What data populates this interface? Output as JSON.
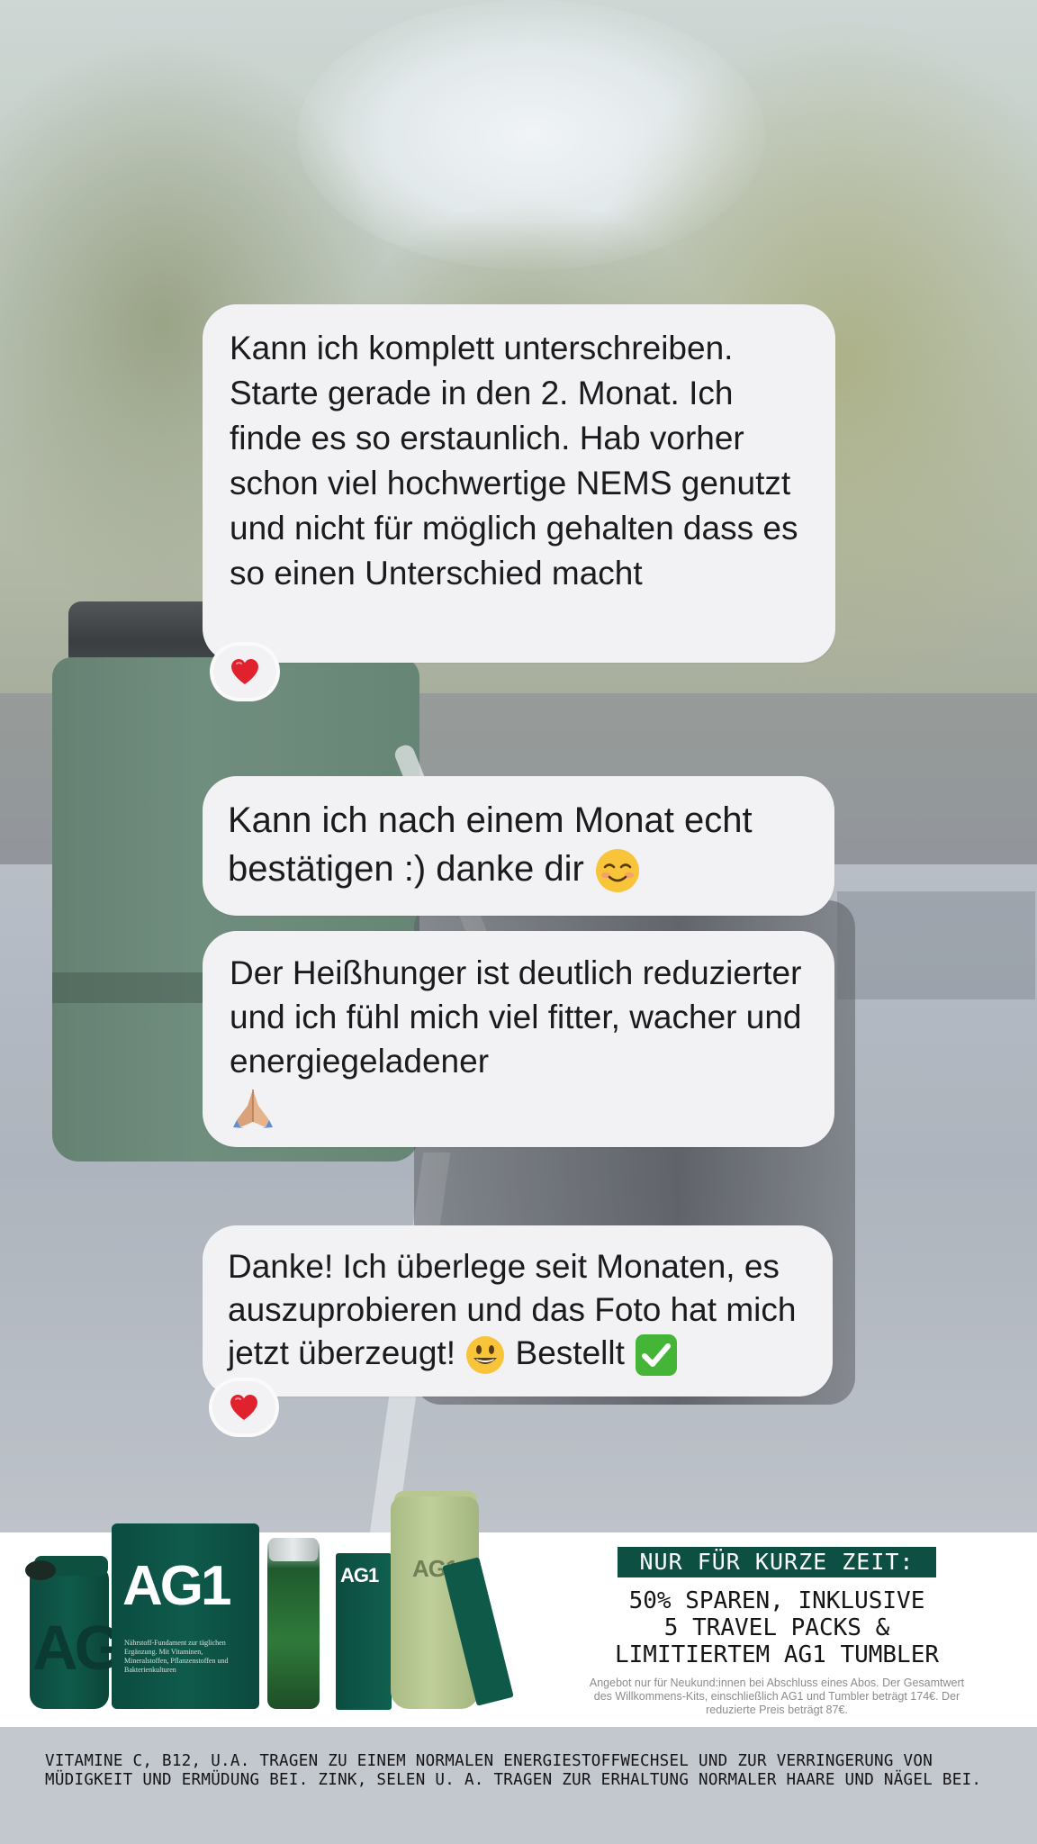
{
  "messages": [
    {
      "text": "Kann ich komplett unterschreiben. Starte gerade in den 2. Monat. Ich finde es so erstaunlich. Hab vorher schon viel hochwertige NEMS genutzt und nicht für möglich gehalten dass es so einen Unterschied macht",
      "reaction": "heart"
    },
    {
      "text": "Kann ich nach einem Monat echt bestätigen :) danke dir",
      "emoji": "smiling-face-icon"
    },
    {
      "text": "Der Heißhunger ist deutlich reduzierter und ich fühl mich viel fitter, wacher und energiegeladener",
      "emoji": "folded-hands-icon"
    },
    {
      "text_before": "Danke! Ich überlege seit Monaten, es auszuprobieren und das Foto hat mich jetzt überzeugt!",
      "emoji": "grinning-face-icon",
      "text_after": "Bestellt",
      "emoji_after": "check-mark-button-icon",
      "reaction": "heart"
    }
  ],
  "promo": {
    "tag": "NUR FÜR KURZE ZEIT:",
    "offer_lines": [
      "50% SPAREN, INKLUSIVE",
      "5 TRAVEL PACKS &",
      "LIMITIERTEM AG1 TUMBLER"
    ],
    "fine_print": "Angebot nur für Neukund:innen bei Abschluss eines Abos. Der Gesamtwert des Willkommens-Kits, einschließlich AG1 und Tumbler beträgt 174€. Der reduzierte Preis beträgt 87€.",
    "brand": "AG1",
    "pouch_text": "Nährstoff-Fundament zur täglichen Ergänzung. Mit Vitaminen, Mineralstoffen, Pflanzenstoffen und Bakterienkulturen"
  },
  "footer": {
    "disclaimer": "VITAMINE C, B12, U.A. TRAGEN ZU EINEM NORMALEN ENERGIESTOFFWECHSEL UND ZUR VERRINGERUNG VON MÜDIGKEIT UND ERMÜDUNG BEI. ZINK, SELEN U. A. TRAGEN ZUR ERHALTUNG NORMALER HAARE UND NÄGEL BEI."
  },
  "colors": {
    "bubble": "#f2f2f5",
    "brand_green": "#0e4f43",
    "heart": "#e0222e",
    "footer_bg": "#c3c8cf"
  }
}
